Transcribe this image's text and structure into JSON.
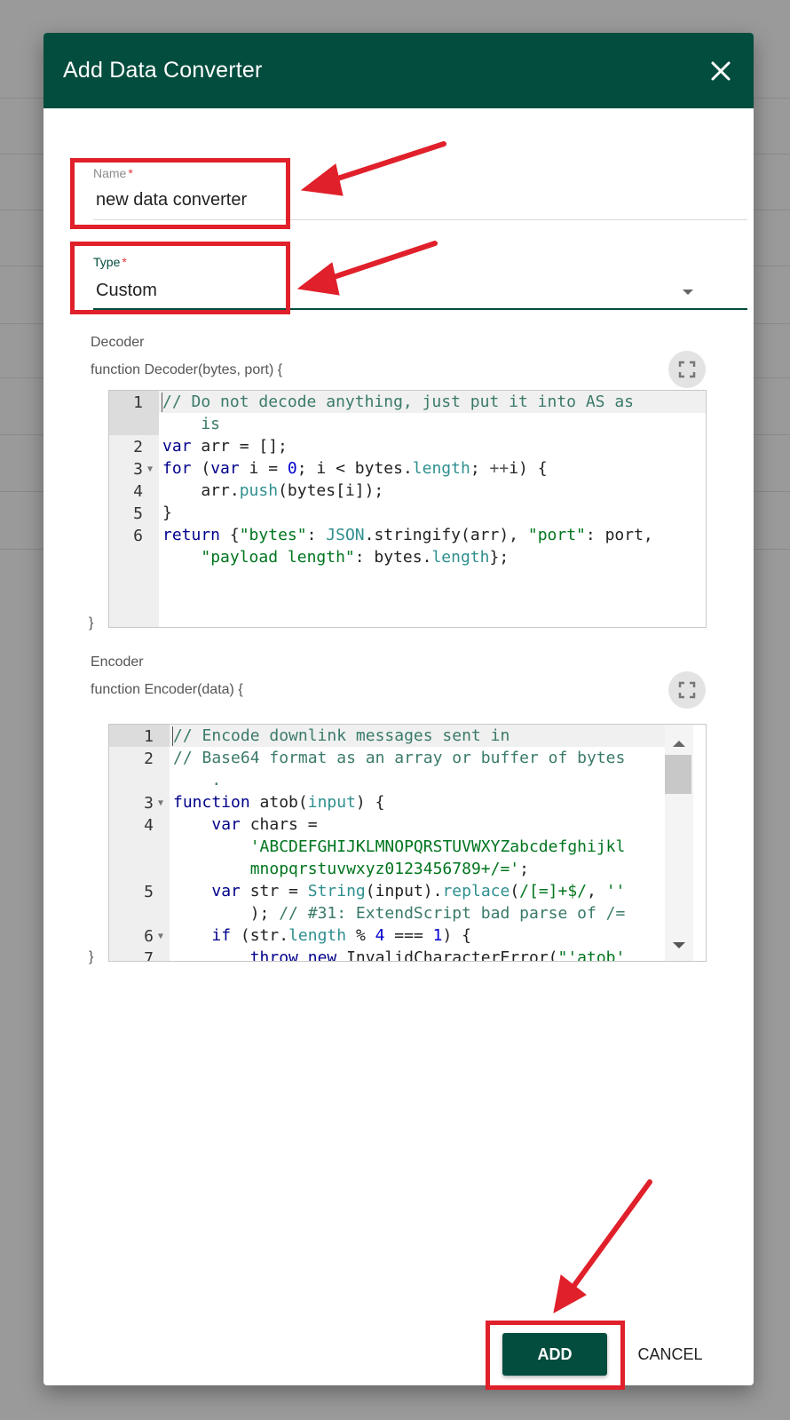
{
  "dialog": {
    "title": "Add Data Converter"
  },
  "name_field": {
    "label": "Name",
    "required_mark": "*",
    "value": "new data converter"
  },
  "type_field": {
    "label": "Type",
    "required_mark": "*",
    "value": "Custom"
  },
  "decoder": {
    "section_label": "Decoder",
    "signature": "function Decoder(bytes, port) {",
    "closing": "}",
    "line_numbers": [
      "1",
      "2",
      "3",
      "4",
      "5",
      "6"
    ]
  },
  "encoder": {
    "section_label": "Encoder",
    "signature": "function Encoder(data) {",
    "closing": "}",
    "line_numbers": [
      "1",
      "2",
      "3",
      "4",
      "5",
      "6",
      "7"
    ]
  },
  "actions": {
    "add_label": "ADD",
    "cancel_label": "CANCEL"
  },
  "colors": {
    "header": "#034d3e",
    "annotation_red": "#e0202a"
  },
  "icons": [
    "close-icon",
    "fullscreen-icon",
    "dropdown-arrow-icon",
    "fold-arrow-icon"
  ]
}
